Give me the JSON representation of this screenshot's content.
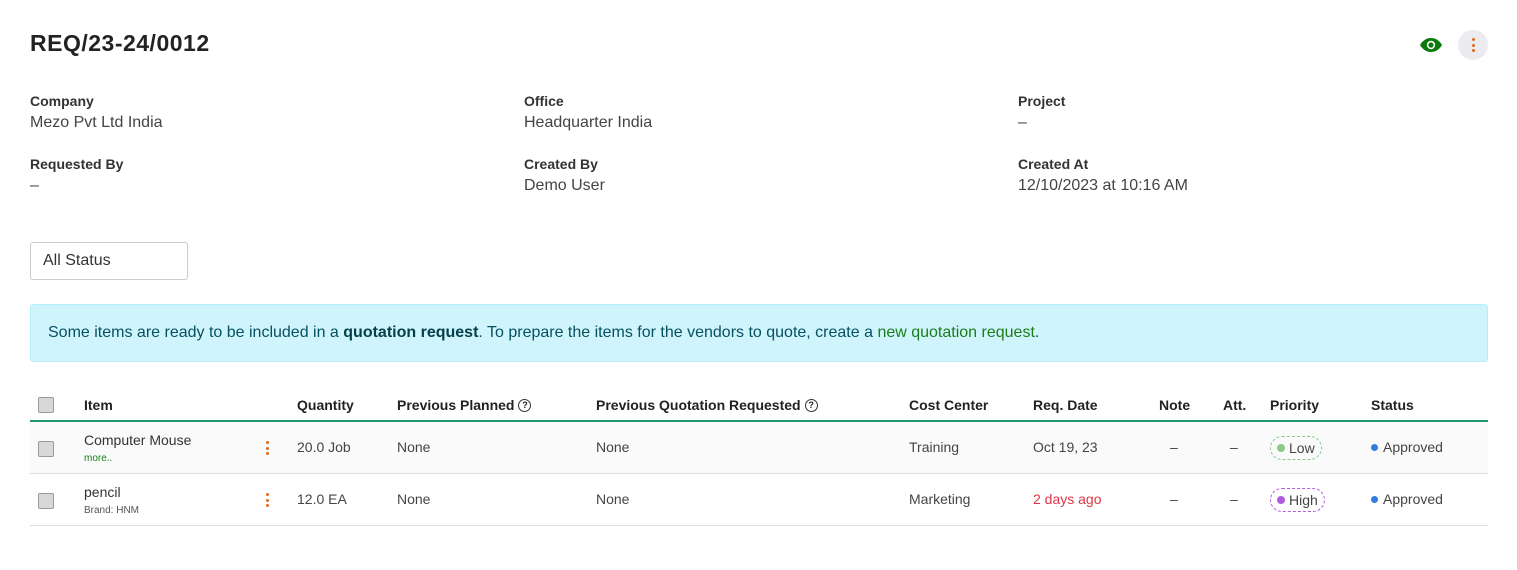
{
  "header": {
    "title": "REQ/23-24/0012",
    "view_icon": "eye-icon",
    "more_icon": "kebab-icon"
  },
  "meta": {
    "company": {
      "label": "Company",
      "value": "Mezo Pvt Ltd India"
    },
    "office": {
      "label": "Office",
      "value": "Headquarter India"
    },
    "project": {
      "label": "Project",
      "value": "–"
    },
    "requested_by": {
      "label": "Requested By",
      "value": "–"
    },
    "created_by": {
      "label": "Created By",
      "value": "Demo User"
    },
    "created_at": {
      "label": "Created At",
      "value": "12/10/2023 at 10:16 AM"
    }
  },
  "filter": {
    "status_value": "All Status"
  },
  "banner": {
    "text1": "Some items are ready to be included in a ",
    "bold": "quotation request",
    "text2": ". To prepare the items for the vendors to quote, create a ",
    "link": "new quotation request",
    "text3": "."
  },
  "table": {
    "headers": {
      "item": "Item",
      "quantity": "Quantity",
      "prev_planned": "Previous Planned",
      "prev_quotation": "Previous Quotation Requested",
      "cost_center": "Cost Center",
      "req_date": "Req. Date",
      "note": "Note",
      "att": "Att.",
      "priority": "Priority",
      "status": "Status"
    },
    "rows": [
      {
        "item": "Computer Mouse",
        "sub": "more..",
        "quantity": "20.0 Job",
        "prev_planned": "None",
        "prev_quotation": "None",
        "cost_center": "Training",
        "req_date": "Oct 19, 23",
        "note": "–",
        "att": "–",
        "priority": "Low",
        "status": "Approved"
      },
      {
        "item": "pencil",
        "sub": "Brand: HNM",
        "quantity": "12.0 EA",
        "prev_planned": "None",
        "prev_quotation": "None",
        "cost_center": "Marketing",
        "req_date": "2 days ago",
        "note": "–",
        "att": "–",
        "priority": "High",
        "status": "Approved"
      }
    ]
  },
  "colors": {
    "accent_green": "#1a7e1a",
    "header_rule": "#1f9a6a",
    "banner_bg": "#cff4fc",
    "overdue_red": "#dc3545",
    "low_priority": "#8cc98c",
    "high_priority": "#b05ce0",
    "approved_blue": "#2e7ee0",
    "kebab_orange": "#e06a1a"
  }
}
